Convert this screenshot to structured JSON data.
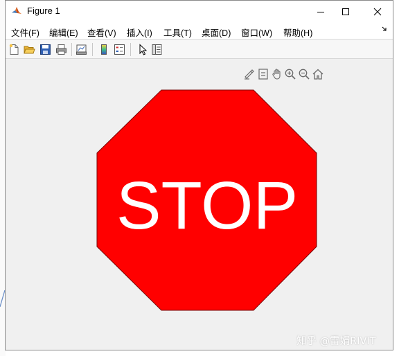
{
  "window": {
    "title": "Figure 1"
  },
  "menu": {
    "file": "文件(F)",
    "edit": "编辑(E)",
    "view": "查看(V)",
    "insert": "插入(I)",
    "tools": "工具(T)",
    "desktop": "桌面(D)",
    "window": "窗口(W)",
    "help": "帮助(H)"
  },
  "figure": {
    "stop_text": "STOP",
    "sign_fill": "#ff0000",
    "sign_stroke": "#7a0000",
    "text_color": "#ffffff"
  },
  "watermark": "知乎 @雷娟RIVIT",
  "icons": {
    "titlebar": [
      "matlab-icon",
      "minimize-icon",
      "maximize-icon",
      "close-icon"
    ],
    "toolbar": [
      "new-figure-icon",
      "open-file-icon",
      "save-icon",
      "print-icon",
      "link-plot-icon",
      "colorbar-icon",
      "legend-icon",
      "edit-plot-icon",
      "property-inspector-icon"
    ],
    "axes_toolbar": [
      "brush-icon",
      "data-tips-icon",
      "pan-icon",
      "zoom-in-icon",
      "zoom-out-icon",
      "home-icon"
    ]
  }
}
